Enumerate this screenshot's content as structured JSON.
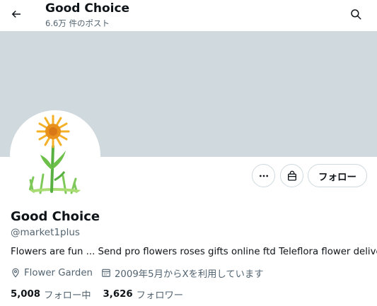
{
  "header": {
    "title": "Good Choice",
    "post_count": "6.6万 件のポスト",
    "back_icon": "arrow-left-icon",
    "search_icon": "search-icon"
  },
  "banner": {
    "color": "#cfd9de"
  },
  "profile": {
    "avatar": "sunflower-drawing",
    "name": "Good Choice",
    "handle": "@market1plus",
    "bio": "Flowers are fun ... Send pro flowers roses gifts online ftd Teleflora flower delivery",
    "location": "Flower Garden",
    "joined": "2009年5月からXを利用しています"
  },
  "actions": {
    "more_icon": "more-icon",
    "shop_icon": "shop-icon",
    "follow_label": "フォロー"
  },
  "stats": {
    "following_count": "5,008",
    "following_label": "フォロー中",
    "followers_count": "3,626",
    "followers_label": "フォロワー"
  },
  "colors": {
    "text": "#0f1419",
    "secondary": "#536471",
    "border": "#cfd9de",
    "banner": "#cfd9de"
  }
}
